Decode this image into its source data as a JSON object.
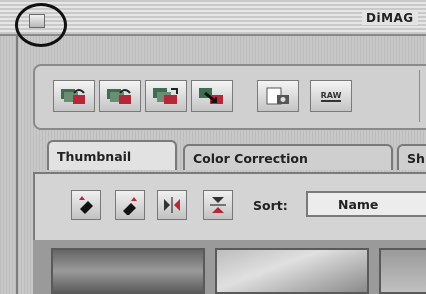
{
  "window": {
    "title": "DiMAG"
  },
  "toolbar": {
    "buttons": [
      {
        "name": "open-scan-button",
        "icon": "stack-rotate-icon"
      },
      {
        "name": "rotate-scan-button",
        "icon": "stack-rotate-icon"
      },
      {
        "name": "copy-stack-button",
        "icon": "stack-copy-icon"
      },
      {
        "name": "export-button",
        "icon": "export-arrow-icon"
      },
      {
        "name": "save-button",
        "icon": "document-camera-icon"
      },
      {
        "name": "raw-button",
        "icon": "raw-icon",
        "label": "RAW"
      }
    ]
  },
  "tabs": [
    {
      "label": "Thumbnail",
      "active": true
    },
    {
      "label": "Color Correction",
      "active": false
    },
    {
      "label": "Sh",
      "active": false
    }
  ],
  "thumbnail_tools": {
    "sort_label": "Sort:",
    "sort_value": "Name"
  }
}
